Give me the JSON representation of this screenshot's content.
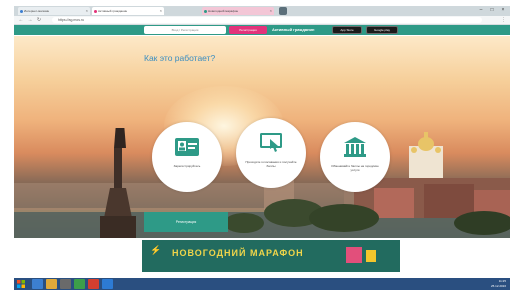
{
  "browser": {
    "tabs": [
      {
        "title": "Интернет-магазин",
        "active": false,
        "favicon_color": "#3c7fd1"
      },
      {
        "title": "Активный гражданин",
        "active": true,
        "favicon_color": "#e2337b"
      },
      {
        "title": "Новогодний марафон",
        "active": false,
        "favicon_color": "#2e9a87"
      }
    ],
    "url": "https://ag.mos.ru",
    "back_icon": "back-arrow-icon",
    "forward_icon": "forward-arrow-icon",
    "reload_icon": "reload-icon"
  },
  "header": {
    "signin_label": "Вход / Регистрация",
    "register_label": "Регистрация",
    "logo_text": "Активный гражданин",
    "app_store_label": "App Store",
    "google_play_label": "Google play",
    "accent_color": "#2e9a87",
    "register_color": "#e2337b"
  },
  "hero": {
    "title": "Как это работает?",
    "steps": [
      {
        "caption": "Зарегистрируйтесь",
        "icon": "id-card-icon"
      },
      {
        "caption": "Проходите голосования и получайте баллы",
        "icon": "touch-screen-icon"
      },
      {
        "caption": "Обменивайте баллы на городские услуги",
        "icon": "museum-icon"
      }
    ],
    "cta_label": "Регистрация",
    "title_color": "#3b8ec1"
  },
  "banner": {
    "text": "НОВОГОДНИЙ МАРАФОН"
  },
  "taskbar": {
    "time": "11:25",
    "date": "25.12.2016"
  }
}
